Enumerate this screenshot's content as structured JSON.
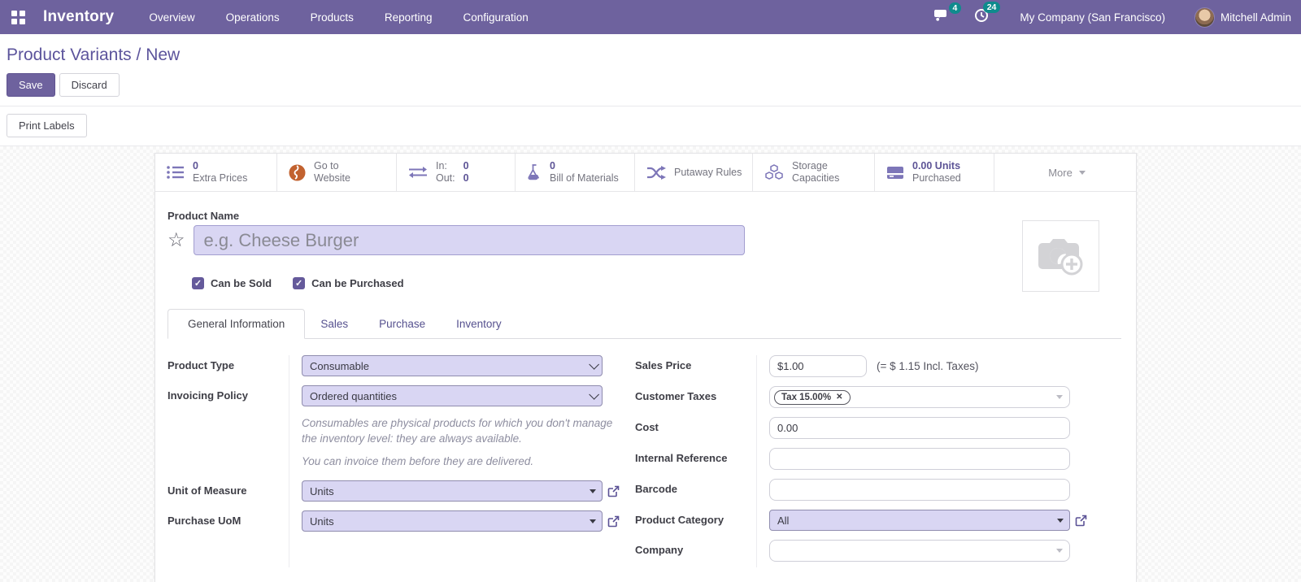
{
  "navbar": {
    "app_name": "Inventory",
    "menu": [
      "Overview",
      "Operations",
      "Products",
      "Reporting",
      "Configuration"
    ],
    "messages_badge": "4",
    "activities_badge": "24",
    "company": "My Company (San Francisco)",
    "user": "Mitchell Admin"
  },
  "breadcrumb": {
    "parent": "Product Variants",
    "separator": " / ",
    "current": "New"
  },
  "actions": {
    "save": "Save",
    "discard": "Discard",
    "print_labels": "Print Labels"
  },
  "statbar": {
    "extra_prices": {
      "value": "0",
      "label": "Extra Prices"
    },
    "website": {
      "line1": "Go to",
      "line2": "Website"
    },
    "inout": {
      "in_label": "In:",
      "in_value": "0",
      "out_label": "Out:",
      "out_value": "0"
    },
    "bom": {
      "value": "0",
      "label": "Bill of Materials"
    },
    "putaway": {
      "label": "Putaway Rules"
    },
    "storage": {
      "line1": "Storage",
      "line2": "Capacities"
    },
    "purchased": {
      "value": "0.00 Units",
      "label": "Purchased"
    },
    "more": {
      "label": "More"
    }
  },
  "product": {
    "name_label": "Product Name",
    "name_placeholder": "e.g. Cheese Burger",
    "can_be_sold": "Can be Sold",
    "can_be_purchased": "Can be Purchased"
  },
  "tabs": [
    "General Information",
    "Sales",
    "Purchase",
    "Inventory"
  ],
  "form": {
    "left": {
      "product_type": {
        "label": "Product Type",
        "value": "Consumable"
      },
      "invoicing_policy": {
        "label": "Invoicing Policy",
        "value": "Ordered quantities"
      },
      "help_line1": "Consumables are physical products for which you don't manage the inventory level: they are always available.",
      "help_line2": "You can invoice them before they are delivered.",
      "uom": {
        "label": "Unit of Measure",
        "value": "Units"
      },
      "purchase_uom": {
        "label": "Purchase UoM",
        "value": "Units"
      }
    },
    "right": {
      "sales_price": {
        "label": "Sales Price",
        "value": "$1.00",
        "note": "(= $ 1.15 Incl. Taxes)"
      },
      "customer_taxes": {
        "label": "Customer Taxes",
        "tag": "Tax 15.00%",
        "remove": "✕"
      },
      "cost": {
        "label": "Cost",
        "value": "0.00"
      },
      "internal_reference": {
        "label": "Internal Reference",
        "value": ""
      },
      "barcode": {
        "label": "Barcode",
        "value": ""
      },
      "product_category": {
        "label": "Product Category",
        "value": "All"
      },
      "company": {
        "label": "Company",
        "value": ""
      }
    }
  },
  "colors": {
    "navbar": "#6e629e",
    "badge": "#0f8b8d",
    "accent_purple": "#5d5496",
    "field_highlight": "#d9d6f3",
    "globe_orange": "#c2622f"
  }
}
